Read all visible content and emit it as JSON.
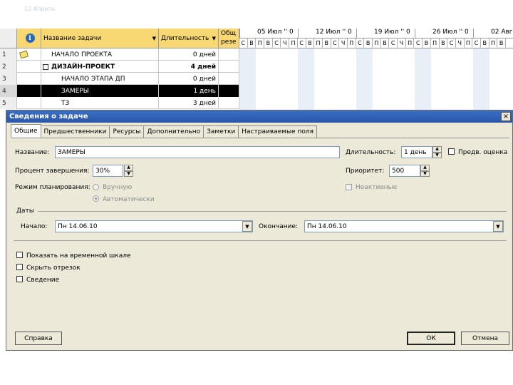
{
  "gantt": {
    "header": {
      "name": "Название задачи",
      "duration": "Длительность",
      "total": "Общ\nрезе"
    },
    "rows": [
      {
        "id": "1",
        "name": "НАЧАЛО ПРОЕКТА",
        "duration": "0 дней"
      },
      {
        "id": "2",
        "name": "ДИЗАЙН-ПРОЕКТ",
        "duration": "4 дней"
      },
      {
        "id": "3",
        "name": "НАЧАЛО ЭТАПА ДП",
        "duration": "0 дней"
      },
      {
        "id": "4",
        "name": "ЗАМЕРЫ",
        "duration": "1 день"
      },
      {
        "id": "5",
        "name": "ТЗ",
        "duration": "3 дней"
      }
    ],
    "weeks": [
      "05 Июл '' 0",
      "12 Июл '' 0",
      "19 Июл '' 0",
      "26 Июл '' 0",
      "02 Авг"
    ],
    "days": [
      "С",
      "В",
      "П",
      "В",
      "С",
      "Ч",
      "П",
      "С",
      "В",
      "П",
      "В",
      "С",
      "Ч",
      "П",
      "С",
      "В",
      "П",
      "В",
      "С",
      "Ч",
      "П",
      "С",
      "В",
      "П",
      "В",
      "С",
      "Ч",
      "П",
      "С",
      "В",
      "П",
      "В"
    ]
  },
  "dialog": {
    "title": "Сведения о задаче",
    "close": "×",
    "tabs": [
      "Общие",
      "Предшественники",
      "Ресурсы",
      "Дополнительно",
      "Заметки",
      "Настраиваемые поля"
    ],
    "name_label": "Название:",
    "name_value": "ЗАМЕРЫ",
    "duration_label": "Длительность:",
    "duration_value": "1 день",
    "estimated_label": "Предв. оценка",
    "percent_label": "Процент завершения:",
    "percent_value": "30%",
    "priority_label": "Приоритет:",
    "priority_value": "500",
    "mode_label": "Режим планирования:",
    "mode_manual": "Вручную",
    "mode_auto": "Автоматически",
    "inactive_label": "Неактивные",
    "dates_label": "Даты",
    "start_label": "Начало:",
    "start_value": "Пн 14.06.10",
    "finish_label": "Окончание:",
    "finish_value": "Пн 14.06.10",
    "show_timeline": "Показать на временной шкале",
    "hide_bar": "Скрыть отрезок",
    "rollup": "Сведение",
    "help": "Справка",
    "ok": "ОК",
    "cancel": "Отмена"
  },
  "top_faint_text": "12 Апрель"
}
